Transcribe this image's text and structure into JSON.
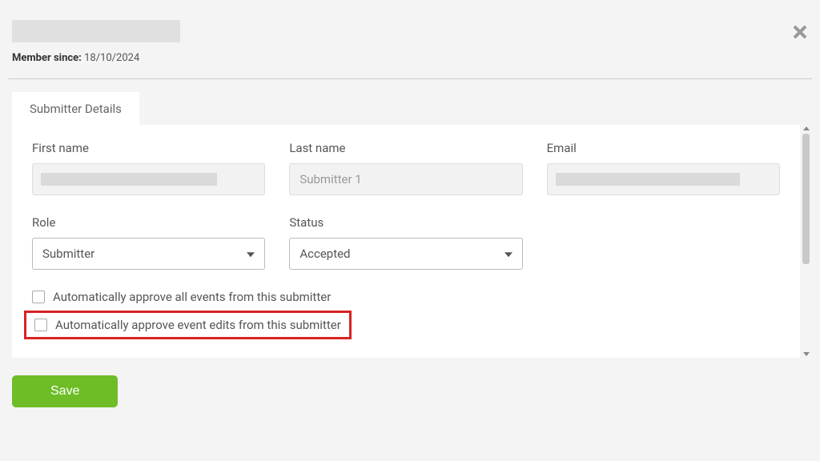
{
  "header": {
    "member_since_prefix": "Member since:",
    "member_since_date": "18/10/2024"
  },
  "tabs": {
    "active": "Submitter Details"
  },
  "fields": {
    "first_name": {
      "label": "First name",
      "value": ""
    },
    "last_name": {
      "label": "Last name",
      "value": "Submitter 1"
    },
    "email": {
      "label": "Email",
      "value": ""
    },
    "role": {
      "label": "Role",
      "value": "Submitter"
    },
    "status": {
      "label": "Status",
      "value": "Accepted"
    }
  },
  "checkboxes": {
    "approve_events": {
      "label": "Automatically approve all events from this submitter",
      "checked": false
    },
    "approve_edits": {
      "label": "Automatically approve event edits from this submitter",
      "checked": false
    }
  },
  "actions": {
    "save": "Save"
  }
}
